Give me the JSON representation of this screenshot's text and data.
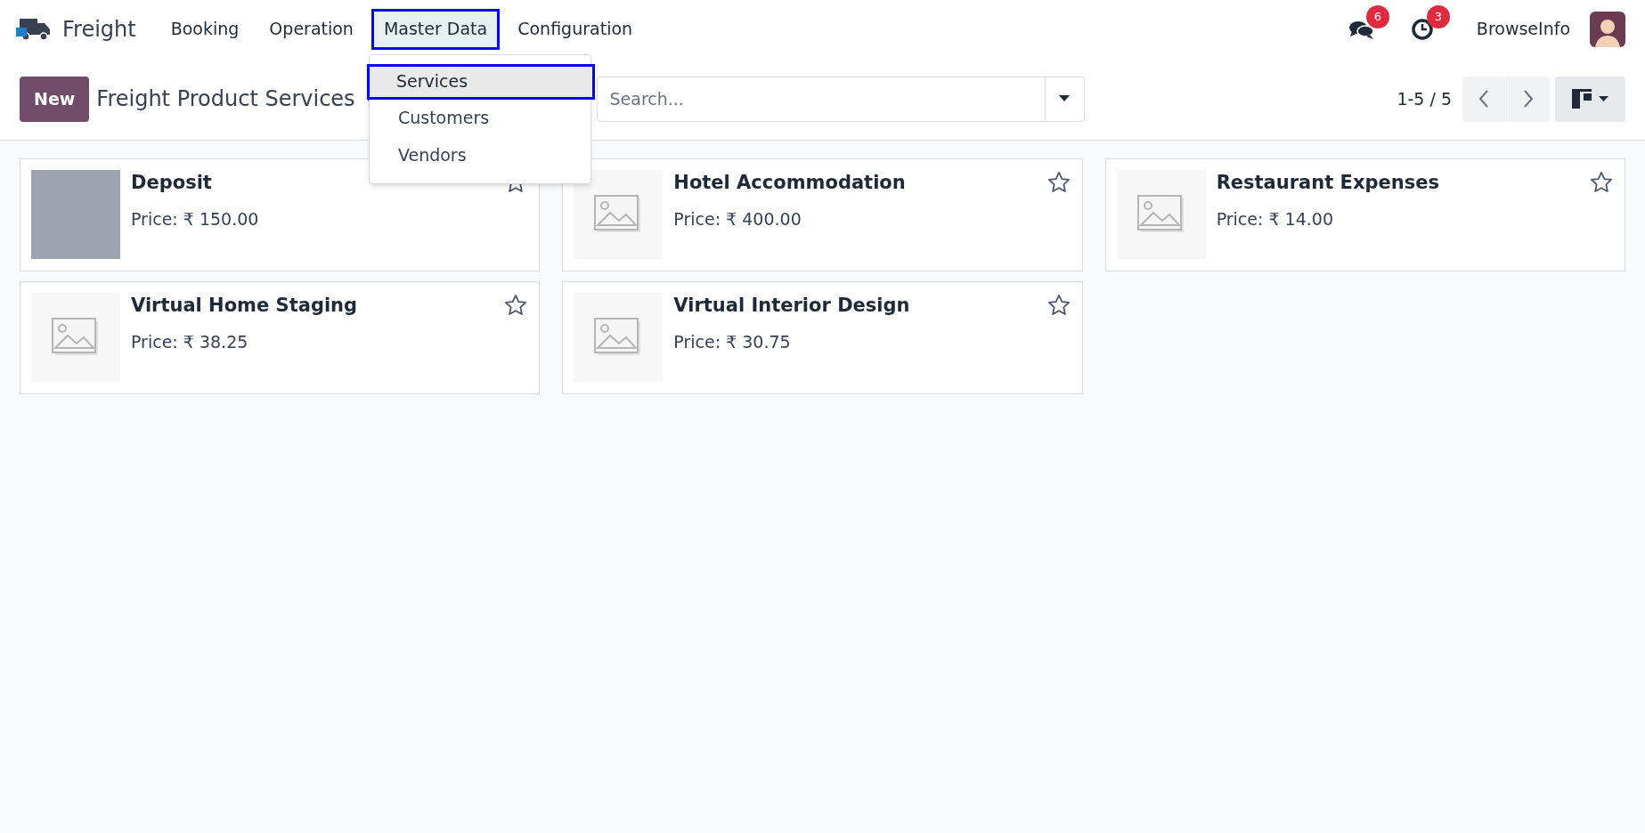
{
  "app": {
    "name": "Freight"
  },
  "menu": [
    {
      "label": "Booking",
      "selected": false
    },
    {
      "label": "Operation",
      "selected": false
    },
    {
      "label": "Master Data",
      "selected": true
    },
    {
      "label": "Configuration",
      "selected": false
    }
  ],
  "dropdown": {
    "items": [
      {
        "label": "Services",
        "selected": true
      },
      {
        "label": "Customers",
        "selected": false
      },
      {
        "label": "Vendors",
        "selected": false
      }
    ]
  },
  "systray": {
    "messages_count": "6",
    "activities_count": "3",
    "company": "BrowseInfo"
  },
  "control_panel": {
    "new_button": "New",
    "title": "Freight Product Services",
    "search": {
      "placeholder": "Search..."
    },
    "pager": "1-5 / 5"
  },
  "cards": [
    {
      "name": "Deposit",
      "price": "Price: ₹ 150.00",
      "kind": "photo",
      "favorite": false
    },
    {
      "name": "Hotel Accommodation",
      "price": "Price: ₹ 400.00",
      "kind": "placeholder",
      "favorite": false
    },
    {
      "name": "Restaurant Expenses",
      "price": "Price: ₹ 14.00",
      "kind": "placeholder",
      "favorite": false
    },
    {
      "name": "Virtual Home Staging",
      "price": "Price: ₹ 38.25",
      "kind": "placeholder",
      "favorite": false
    },
    {
      "name": "Virtual Interior Design",
      "price": "Price: ₹ 30.75",
      "kind": "placeholder",
      "favorite": false
    }
  ]
}
